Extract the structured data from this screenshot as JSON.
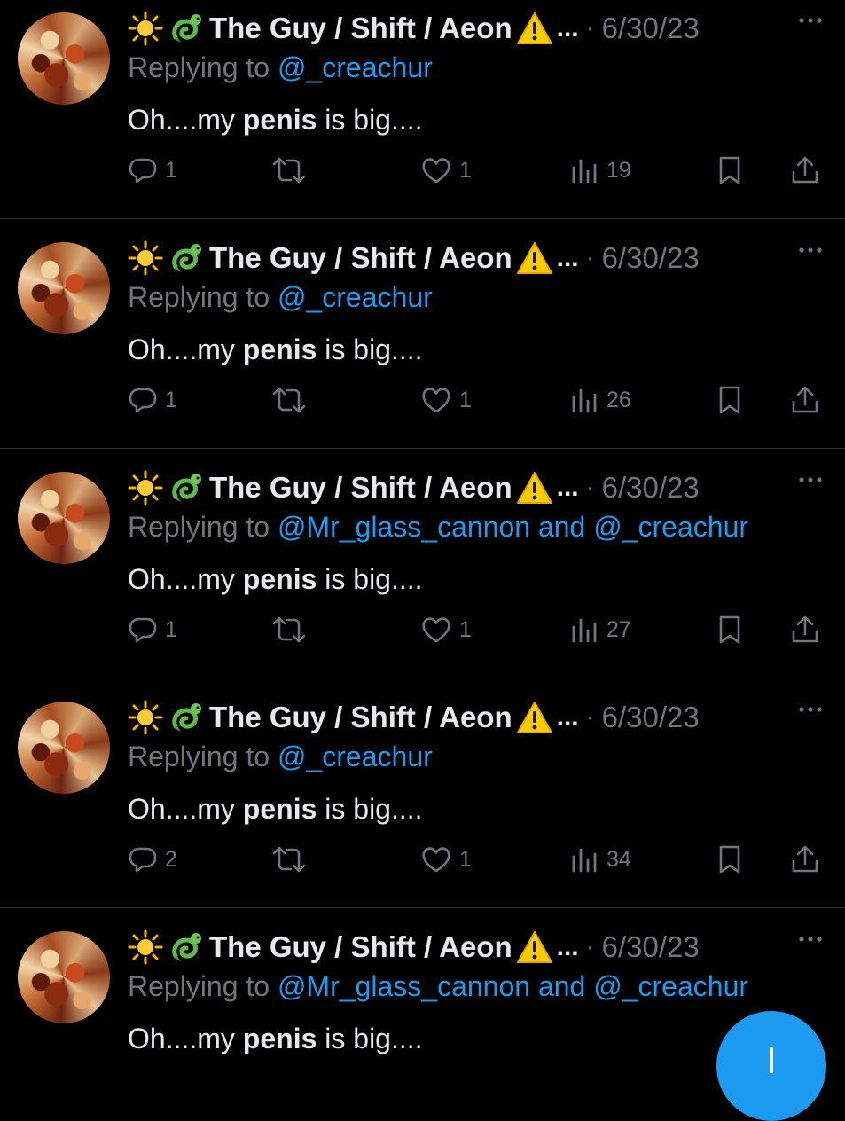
{
  "tweets": [
    {
      "display_name": "The Guy / Shift / Aeon",
      "ellipsis": "...",
      "dot": "·",
      "date": "6/30/23",
      "reply_prefix": "Replying to",
      "reply_handle1": "@_creachur",
      "reply_and": "",
      "reply_handle2": "",
      "text_before": "Oh....my ",
      "text_bold": "penis",
      "text_after": " is big....",
      "comments": "1",
      "likes": "1",
      "views": "19"
    },
    {
      "display_name": "The Guy / Shift / Aeon",
      "ellipsis": "...",
      "dot": "·",
      "date": "6/30/23",
      "reply_prefix": "Replying to",
      "reply_handle1": "@_creachur",
      "reply_and": "",
      "reply_handle2": "",
      "text_before": "Oh....my ",
      "text_bold": "penis",
      "text_after": " is big....",
      "comments": "1",
      "likes": "1",
      "views": "26"
    },
    {
      "display_name": "The Guy / Shift / Aeon",
      "ellipsis": "...",
      "dot": "·",
      "date": "6/30/23",
      "reply_prefix": "Replying to",
      "reply_handle1": "@Mr_glass_cannon",
      "reply_and": "and",
      "reply_handle2": "@_creachur",
      "text_before": "Oh....my ",
      "text_bold": "penis",
      "text_after": " is big....",
      "comments": "1",
      "likes": "1",
      "views": "27"
    },
    {
      "display_name": "The Guy / Shift / Aeon",
      "ellipsis": "...",
      "dot": "·",
      "date": "6/30/23",
      "reply_prefix": "Replying to",
      "reply_handle1": "@_creachur",
      "reply_and": "",
      "reply_handle2": "",
      "text_before": "Oh....my ",
      "text_bold": "penis",
      "text_after": " is big....",
      "comments": "2",
      "likes": "1",
      "views": "34"
    },
    {
      "display_name": "The Guy / Shift / Aeon",
      "ellipsis": "...",
      "dot": "·",
      "date": "6/30/23",
      "reply_prefix": "Replying to",
      "reply_handle1": "@Mr_glass_cannon",
      "reply_and": "and",
      "reply_handle2": "@_creachur",
      "text_before": "Oh....my ",
      "text_bold": "penis",
      "text_after": " is big....",
      "comments": "",
      "likes": "",
      "views": ""
    }
  ],
  "icons": {
    "avatar": "avatar-image",
    "sun": "sun-emoji-icon",
    "dragon": "dragon-emoji-icon",
    "warning": "warning-emoji-icon",
    "more": "more-icon",
    "reply": "comment-icon",
    "retweet": "retweet-icon",
    "like": "heart-icon",
    "views": "analytics-icon",
    "bookmark": "bookmark-icon",
    "share": "share-icon",
    "compose": "compose-button"
  },
  "colors": {
    "background": "#000000",
    "text": "#e7e9ea",
    "muted": "#71767b",
    "accent": "#1d9bf0",
    "divider": "#2f3336"
  }
}
